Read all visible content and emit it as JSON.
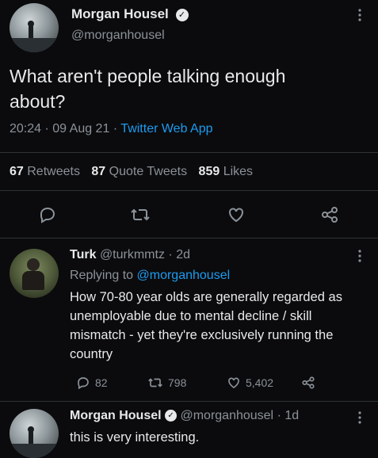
{
  "main_tweet": {
    "author_name": "Morgan Housel",
    "author_handle": "@morganhousel",
    "text": "What aren't people talking enough about?",
    "time": "20:24",
    "date": "09 Aug 21",
    "source": "Twitter Web App",
    "retweets_count": "67",
    "retweets_label": "Retweets",
    "quotes_count": "87",
    "quotes_label": "Quote Tweets",
    "likes_count": "859",
    "likes_label": "Likes"
  },
  "reply_1": {
    "author_name": "Turk",
    "author_handle": "@turkmmtz",
    "age": "2d",
    "replying_to_label": "Replying to",
    "replying_to_handle": "@morganhousel",
    "text": "How 70-80 year olds are generally regarded as unemployable due to mental decline / skill mismatch - yet they're exclusively running the country",
    "replies": "82",
    "retweets": "798",
    "likes": "5,402"
  },
  "reply_2": {
    "author_name": "Morgan Housel",
    "author_handle": "@morganhousel",
    "age": "1d",
    "text": "this is very interesting."
  },
  "icons": {
    "reply": "reply-icon",
    "retweet": "retweet-icon",
    "like": "heart-icon",
    "share": "share-icon",
    "verified": "verified-badge-icon",
    "more": "more-options-icon"
  },
  "colors": {
    "background": "#0b0b0d",
    "text": "#e7e9ea",
    "muted": "#8b9299",
    "link": "#1d9bf0"
  }
}
